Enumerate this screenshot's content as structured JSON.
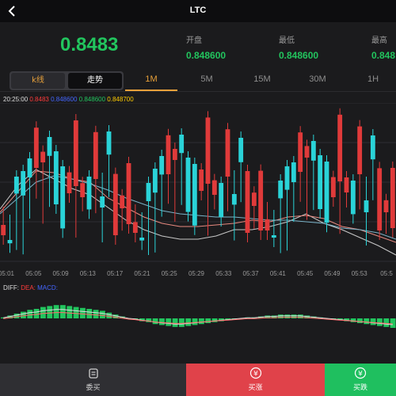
{
  "header": {
    "title": "LTC"
  },
  "price": {
    "current": "0.8483",
    "stats": [
      {
        "label": "开盘",
        "value": "0.848600"
      },
      {
        "label": "最低",
        "value": "0.848600"
      },
      {
        "label": "最高",
        "value": "0.848"
      }
    ]
  },
  "chart_tabs": {
    "modes": [
      "k线",
      "走势"
    ],
    "periods": [
      "1M",
      "5M",
      "15M",
      "30M",
      "1H"
    ],
    "active_period": "1M"
  },
  "indicator_legend": {
    "time": "20:25:00",
    "values": [
      "0.8483",
      "0.848600",
      "0.848600",
      "0.848700"
    ],
    "colors": [
      "#ff3b3b",
      "#4466ff",
      "#22c55e",
      "#ffcc00"
    ]
  },
  "macd_legend": {
    "labels": [
      "DIFF:",
      "DEA:",
      "MACD:"
    ],
    "colors": [
      "#dddddd",
      "#ff3b3b",
      "#4466ff"
    ]
  },
  "colors": {
    "up": "#22c55e",
    "down": "#ff3b3b",
    "accent": "#e8a13a",
    "ma1": "#c8c8c8",
    "ma2": "#e88a80",
    "ma3": "#7ab3c8"
  },
  "chart_data": [
    {
      "type": "candlestick",
      "x_labels": [
        "05:01",
        "05:05",
        "05:09",
        "05:13",
        "05:17",
        "05:21",
        "05:25",
        "05:29",
        "05:33",
        "05:37",
        "05:41",
        "05:45",
        "05:49",
        "05:53",
        "05:5"
      ],
      "candles": [
        [
          26,
          33,
          37,
          19
        ],
        [
          12,
          26,
          31,
          14
        ],
        [
          41,
          48,
          12,
          52
        ],
        [
          44,
          58,
          12,
          59
        ],
        [
          53,
          63,
          33,
          65
        ],
        [
          82,
          62,
          44,
          57
        ],
        [
          71,
          64,
          31,
          64
        ],
        [
          66,
          77,
          40,
          78
        ],
        [
          33,
          44,
          39,
          67
        ],
        [
          22,
          61,
          73,
          61
        ],
        [
          55,
          53,
          68,
          42
        ],
        [
          92,
          45,
          23,
          50
        ],
        [
          50,
          40,
          38,
          41
        ],
        [
          31,
          37,
          45,
          52
        ],
        [
          84,
          40,
          38,
          54
        ],
        [
          34,
          52,
          18,
          41
        ],
        [
          65,
          57,
          45,
          80
        ],
        [
          57,
          20,
          19,
          18
        ],
        [
          41,
          29,
          25,
          33
        ],
        [
          59,
          35,
          46,
          21
        ]
      ],
      "ma_lines": [
        [
          33,
          48,
          58,
          52,
          46,
          42,
          34,
          26,
          20,
          16,
          14,
          14,
          16,
          20,
          20,
          22,
          25,
          30,
          24,
          20,
          15,
          10,
          4
        ],
        [
          31,
          44,
          57,
          56,
          52,
          50,
          40,
          34,
          28,
          24,
          22,
          22,
          23,
          24,
          26,
          25,
          28,
          29,
          27,
          22,
          20,
          16,
          12
        ],
        [
          30,
          40,
          50,
          54,
          52,
          49,
          45,
          40,
          36,
          32,
          30,
          29,
          28,
          28,
          27,
          26,
          26,
          25,
          24,
          21,
          20,
          18,
          14
        ]
      ]
    },
    {
      "type": "bar",
      "series": [
        {
          "values": [
            1,
            3,
            5,
            7,
            9,
            10,
            12,
            13,
            14,
            14,
            13,
            12,
            11,
            10,
            9,
            8,
            6,
            4,
            2,
            0,
            -1,
            -3,
            -4,
            -6,
            -7,
            -8,
            -9,
            -9,
            -8,
            -7,
            -6,
            -5,
            -4,
            -3,
            -2,
            -1,
            0,
            1,
            1,
            2,
            3,
            3,
            4,
            4,
            4,
            4,
            3,
            2,
            1,
            0,
            -1,
            -2,
            -3,
            -4,
            -5,
            -6,
            -7,
            -8,
            -9,
            -10
          ]
        }
      ]
    }
  ],
  "bottom_bar": [
    {
      "label": "委买",
      "icon": "order-icon"
    },
    {
      "label": "买涨",
      "icon": "yen-icon"
    },
    {
      "label": "买跌",
      "icon": "yen-icon"
    }
  ]
}
